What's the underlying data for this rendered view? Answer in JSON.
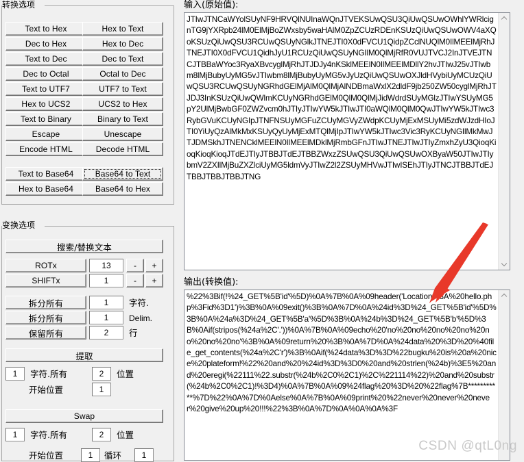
{
  "app": {
    "accent_red": "#e8392a",
    "watermark": "CSDN @qtL0ng"
  },
  "conversion_group": {
    "title": "转换选项",
    "buttons": [
      {
        "label": "Text to Hex",
        "focused": false
      },
      {
        "label": "Hex to Text",
        "focused": false
      },
      {
        "label": "Dec to Hex",
        "focused": false
      },
      {
        "label": "Hex to Dec",
        "focused": false
      },
      {
        "label": "Text to Dec",
        "focused": false
      },
      {
        "label": "Dec to Text",
        "focused": false
      },
      {
        "label": "Dec to Octal",
        "focused": false
      },
      {
        "label": "Octal to Dec",
        "focused": false
      },
      {
        "label": "Text to UTF7",
        "focused": false
      },
      {
        "label": "UTF7 to Text",
        "focused": false
      },
      {
        "label": "Hex to UCS2",
        "focused": false
      },
      {
        "label": "UCS2 to Hex",
        "focused": false
      },
      {
        "label": "Text to Binary",
        "focused": false
      },
      {
        "label": "Binary to Text",
        "focused": false
      },
      {
        "label": "Escape",
        "focused": false
      },
      {
        "label": "Unescape",
        "focused": false
      },
      {
        "label": "Encode HTML",
        "focused": false
      },
      {
        "label": "Decode HTML",
        "focused": false
      }
    ],
    "base64_buttons": [
      {
        "label": "Text to Base64",
        "focused": false
      },
      {
        "label": "Base64 to Text",
        "focused": true
      },
      {
        "label": "Hex to Base64",
        "focused": false
      },
      {
        "label": "Base64 to Hex",
        "focused": false
      }
    ]
  },
  "transform_group": {
    "title": "变换选项",
    "search_replace_label": "搜索/替换文本",
    "rot": {
      "button_label": "ROTx",
      "value": "13",
      "minus_label": "-",
      "plus_label": "+"
    },
    "shift": {
      "button_label": "SHIFTx",
      "value": "1",
      "minus_label": "-",
      "plus_label": "+"
    },
    "split_rows": [
      {
        "button_label": "拆分所有",
        "value": "1",
        "unit": "字符."
      },
      {
        "button_label": "拆分所有",
        "value": "1",
        "unit": "Delim."
      },
      {
        "button_label": "保留所有",
        "value": "2",
        "unit": "行"
      }
    ],
    "extract": {
      "button_label": "提取",
      "count_value": "1",
      "count_label": "字符.所有",
      "pos_value": "2",
      "pos_label": "位置",
      "start_label": "开始位置",
      "start_value": "1"
    },
    "swap": {
      "button_label": "Swap",
      "count_value": "1",
      "count_label": "字符.所有",
      "pos_value": "2",
      "pos_label": "位置",
      "start_label": "开始位置",
      "start_value": "1",
      "loop_label": "循环",
      "loop_value": "1"
    }
  },
  "input_panel": {
    "label": "输入(原始值):",
    "value": "JTIwJTNCaWYolSUyNF9HRVQlNUInaWQnJTVEKSUwQSU3QiUwQSUwOWhlYWRlcignTG9jYXRpb24lM0ElMjBoZWxsby5waHAlM0ZpZCUzRDEnKSUzQiUwQSUwOWV4aXQoKSUzQiUwQSU3RCUwQSUyNGlkJTNEJTI0X0dFVCU1QidpZCclNUQlM0IlMEElMjRhJTNEJTI0X0dFVCU1QidhJyU1RCUzQiUwQSUyNGIlM0QlMjRfR0VUJTVCJ2InJTVEJTNCJTBBaWYoc3RyaXBvcyglMjRhJTJDJy4nKSklMEElN0IlMEElMDllY2hvJTIwJ25vJTIwbm8lMjBubyUyMG5vJTIwbm8lMjBubyUyMG5vJyUzQiUwQSUwOXJldHVybiUyMCUzQiUwQSU3RCUwQSUyNGRhdGElMjAlM0QlMjAlNDBmaWxlX2dldF9jb250ZW50cyglMjRhJTJDJ3InKSUzQiUwQWlmKCUyNGRhdGElM0QlM0QlMjJidWdrdSUyMGlzJTIwYSUyMG5pY2UlMjBwbGF0ZWZvcm0hJTIyJTIwYW5kJTIwJTI0aWQlM0QlM0QwJTIwYW5kJTIwc3RybGVuKCUyNGIpJTNFNSUyMGFuZCUyMGVyZWdpKCUyMjExMSUyMi5zdWJzdHIoJTI0YiUyQzAlMkMxKSUyQyUyMjExMTQlMjIpJTIwYW5kJTIwc3Vic3RyKCUyNGIlMkMwJTJDMSkhJTNENCklMEElN0IlMEElMDklMjRmbGFnJTIwJTNEJTIwJTIyZmxhZyU3QioqKioqKioqKioqJTdEJTIyJTBBJTdEJTBBZWxzZSUwQSU3QiUwQSUwOXByaW50JTIwJTIybmV2ZXIlMjBuZXZlciUyMG5ldmVyJTIwZ2l2ZSUyMHVwJTIwISEhJTIyJTNCJTBBJTdEJTBBJTBBJTBBJTNG"
  },
  "output_panel": {
    "label": "输出(转换值):",
    "value": "%22%3Bif(!%24_GET%5B'id'%5D)%0A%7B%0A%09header('Location%3A%20hello.php%3Fid%3D1')%3B%0A%09exit()%3B%0A%7D%0A%24id%3D%24_GET%5B'id'%5D%3B%0A%24a%3D%24_GET%5B'a'%5D%3B%0A%24b%3D%24_GET%5B'b'%5D%3B%0Aif(stripos(%24a%2C'.'))%0A%7B%0A%09echo%20'no%20no%20no%20no%20no%20no%20no'%3B%0A%09return%20%3B%0A%7D%0A%24data%20%3D%20%40file_get_contents(%24a%2C'r')%3B%0Aif(%24data%3D%3D%22bugku%20is%20a%20nice%20plateform!%22%20and%20%24id%3D%3D0%20and%20strlen(%24b)%3E5%20and%20eregi(%22111%22.substr(%24b%2C0%2C1)%2C%221114%22)%20and%20substr(%24b%2C0%2C1)!%3D4)%0A%7B%0A%09%24flag%20%3D%20%22flag%7B***********%7D%22%0A%7D%0Aelse%0A%7B%0A%09print%20%22never%20never%20never%20give%20up%20!!!%22%3B%0A%7D%0A%0A%0A%3F"
  },
  "icons": {
    "scroll_up": "chevron-up-icon",
    "scroll_down": "chevron-down-icon"
  }
}
